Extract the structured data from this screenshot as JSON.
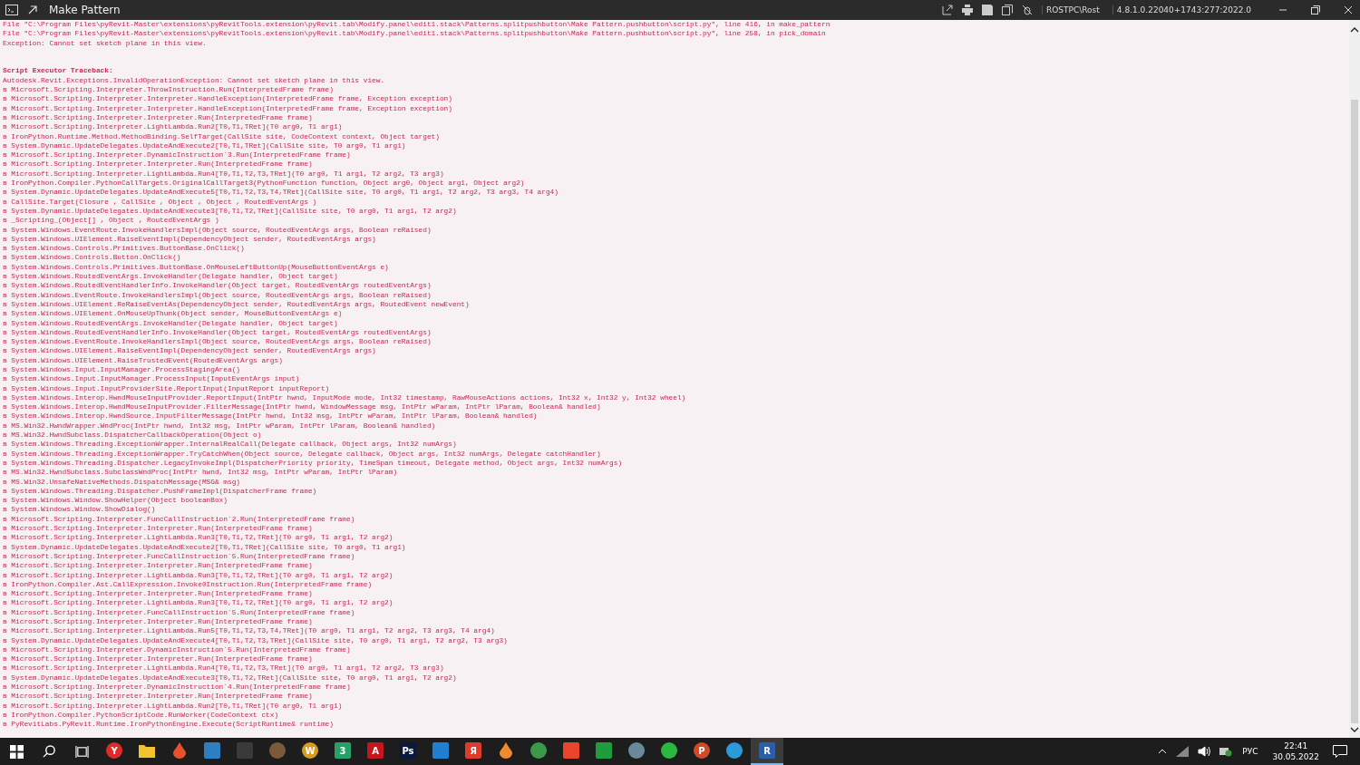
{
  "window": {
    "title": "Make Pattern",
    "user": "ROSTPC\\Rost",
    "version": "4.8.1.0.22040+1743:277:2022.0"
  },
  "output": {
    "lines": [
      {
        "kind": "error",
        "text": "File \"C:\\Program Files\\pyRevit-Master\\extensions\\pyRevitTools.extension\\pyRevit.tab\\Modify.panel\\edit1.stack\\Patterns.splitpushbutton\\Make Pattern.pushbutton\\script.py\", line 416, in make_pattern"
      },
      {
        "kind": "error",
        "text": "File \"C:\\Program Files\\pyRevit-Master\\extensions\\pyRevitTools.extension\\pyRevit.tab\\Modify.panel\\edit1.stack\\Patterns.splitpushbutton\\Make Pattern.pushbutton\\script.py\", line 258, in pick_domain"
      },
      {
        "kind": "error",
        "text": "Exception: Cannot set sketch plane in this view."
      },
      {
        "kind": "blank"
      },
      {
        "kind": "blank"
      },
      {
        "kind": "heading",
        "text": "Script Executor Traceback:"
      },
      {
        "kind": "error",
        "text": "Autodesk.Revit.Exceptions.InvalidOperationException: Cannot set sketch plane in this view."
      },
      {
        "kind": "frame",
        "text": "в Microsoft.Scripting.Interpreter.ThrowInstruction.Run(InterpretedFrame frame)"
      },
      {
        "kind": "frame",
        "text": "в Microsoft.Scripting.Interpreter.Interpreter.HandleException(InterpretedFrame frame, Exception exception)"
      },
      {
        "kind": "frame",
        "text": "в Microsoft.Scripting.Interpreter.Interpreter.HandleException(InterpretedFrame frame, Exception exception)"
      },
      {
        "kind": "frame",
        "text": "в Microsoft.Scripting.Interpreter.Interpreter.Run(InterpretedFrame frame)"
      },
      {
        "kind": "frame",
        "text": "в Microsoft.Scripting.Interpreter.LightLambda.Run2[T0,T1,TRet](T0 arg0, T1 arg1)"
      },
      {
        "kind": "frame",
        "text": "в IronPython.Runtime.Method.MethodBinding.SelfTarget(CallSite site, CodeContext context, Object target)"
      },
      {
        "kind": "frame",
        "text": "в System.Dynamic.UpdateDelegates.UpdateAndExecute2[T0,T1,TRet](CallSite site, T0 arg0, T1 arg1)"
      },
      {
        "kind": "frame",
        "text": "в Microsoft.Scripting.Interpreter.DynamicInstruction`3.Run(InterpretedFrame frame)"
      },
      {
        "kind": "frame",
        "text": "в Microsoft.Scripting.Interpreter.Interpreter.Run(InterpretedFrame frame)"
      },
      {
        "kind": "frame",
        "text": "в Microsoft.Scripting.Interpreter.LightLambda.Run4[T0,T1,T2,T3,TRet](T0 arg0, T1 arg1, T2 arg2, T3 arg3)"
      },
      {
        "kind": "frame",
        "text": "в IronPython.Compiler.PythonCallTargets.OriginalCallTarget3(PythonFunction function, Object arg0, Object arg1, Object arg2)"
      },
      {
        "kind": "frame",
        "text": "в System.Dynamic.UpdateDelegates.UpdateAndExecute5[T0,T1,T2,T3,T4,TRet](CallSite site, T0 arg0, T1 arg1, T2 arg2, T3 arg3, T4 arg4)"
      },
      {
        "kind": "frame",
        "text": "в CallSite.Target(Closure , CallSite , Object , Object , RoutedEventArgs )"
      },
      {
        "kind": "frame",
        "text": "в System.Dynamic.UpdateDelegates.UpdateAndExecute3[T0,T1,T2,TRet](CallSite site, T0 arg0, T1 arg1, T2 arg2)"
      },
      {
        "kind": "frame",
        "text": "в _Scripting_(Object[] , Object , RoutedEventArgs )"
      },
      {
        "kind": "frame",
        "text": "в System.Windows.EventRoute.InvokeHandlersImpl(Object source, RoutedEventArgs args, Boolean reRaised)"
      },
      {
        "kind": "frame",
        "text": "в System.Windows.UIElement.RaiseEventImpl(DependencyObject sender, RoutedEventArgs args)"
      },
      {
        "kind": "frame",
        "text": "в System.Windows.Controls.Primitives.ButtonBase.OnClick()"
      },
      {
        "kind": "frame",
        "text": "в System.Windows.Controls.Button.OnClick()"
      },
      {
        "kind": "frame",
        "text": "в System.Windows.Controls.Primitives.ButtonBase.OnMouseLeftButtonUp(MouseButtonEventArgs e)"
      },
      {
        "kind": "frame",
        "text": "в System.Windows.RoutedEventArgs.InvokeHandler(Delegate handler, Object target)"
      },
      {
        "kind": "frame",
        "text": "в System.Windows.RoutedEventHandlerInfo.InvokeHandler(Object target, RoutedEventArgs routedEventArgs)"
      },
      {
        "kind": "frame",
        "text": "в System.Windows.EventRoute.InvokeHandlersImpl(Object source, RoutedEventArgs args, Boolean reRaised)"
      },
      {
        "kind": "frame",
        "text": "в System.Windows.UIElement.ReRaiseEventAs(DependencyObject sender, RoutedEventArgs args, RoutedEvent newEvent)"
      },
      {
        "kind": "frame",
        "text": "в System.Windows.UIElement.OnMouseUpThunk(Object sender, MouseButtonEventArgs e)"
      },
      {
        "kind": "frame",
        "text": "в System.Windows.RoutedEventArgs.InvokeHandler(Delegate handler, Object target)"
      },
      {
        "kind": "frame",
        "text": "в System.Windows.RoutedEventHandlerInfo.InvokeHandler(Object target, RoutedEventArgs routedEventArgs)"
      },
      {
        "kind": "frame",
        "text": "в System.Windows.EventRoute.InvokeHandlersImpl(Object source, RoutedEventArgs args, Boolean reRaised)"
      },
      {
        "kind": "frame",
        "text": "в System.Windows.UIElement.RaiseEventImpl(DependencyObject sender, RoutedEventArgs args)"
      },
      {
        "kind": "frame",
        "text": "в System.Windows.UIElement.RaiseTrustedEvent(RoutedEventArgs args)"
      },
      {
        "kind": "frame",
        "text": "в System.Windows.Input.InputManager.ProcessStagingArea()"
      },
      {
        "kind": "frame",
        "text": "в System.Windows.Input.InputManager.ProcessInput(InputEventArgs input)"
      },
      {
        "kind": "frame",
        "text": "в System.Windows.Input.InputProviderSite.ReportInput(InputReport inputReport)"
      },
      {
        "kind": "frame",
        "text": "в System.Windows.Interop.HwndMouseInputProvider.ReportInput(IntPtr hwnd, InputMode mode, Int32 timestamp, RawMouseActions actions, Int32 x, Int32 y, Int32 wheel)"
      },
      {
        "kind": "frame",
        "text": "в System.Windows.Interop.HwndMouseInputProvider.FilterMessage(IntPtr hwnd, WindowMessage msg, IntPtr wParam, IntPtr lParam, Boolean& handled)"
      },
      {
        "kind": "frame",
        "text": "в System.Windows.Interop.HwndSource.InputFilterMessage(IntPtr hwnd, Int32 msg, IntPtr wParam, IntPtr lParam, Boolean& handled)"
      },
      {
        "kind": "frame",
        "text": "в MS.Win32.HwndWrapper.WndProc(IntPtr hwnd, Int32 msg, IntPtr wParam, IntPtr lParam, Boolean& handled)"
      },
      {
        "kind": "frame",
        "text": "в MS.Win32.HwndSubclass.DispatcherCallbackOperation(Object o)"
      },
      {
        "kind": "frame",
        "text": "в System.Windows.Threading.ExceptionWrapper.InternalRealCall(Delegate callback, Object args, Int32 numArgs)"
      },
      {
        "kind": "frame",
        "text": "в System.Windows.Threading.ExceptionWrapper.TryCatchWhen(Object source, Delegate callback, Object args, Int32 numArgs, Delegate catchHandler)"
      },
      {
        "kind": "frame",
        "text": "в System.Windows.Threading.Dispatcher.LegacyInvokeImpl(DispatcherPriority priority, TimeSpan timeout, Delegate method, Object args, Int32 numArgs)"
      },
      {
        "kind": "frame",
        "text": "в MS.Win32.HwndSubclass.SubclassWndProc(IntPtr hwnd, Int32 msg, IntPtr wParam, IntPtr lParam)"
      },
      {
        "kind": "frame",
        "text": "в MS.Win32.UnsafeNativeMethods.DispatchMessage(MSG& msg)"
      },
      {
        "kind": "frame",
        "text": "в System.Windows.Threading.Dispatcher.PushFrameImpl(DispatcherFrame frame)"
      },
      {
        "kind": "frame",
        "text": "в System.Windows.Window.ShowHelper(Object booleanBox)"
      },
      {
        "kind": "frame",
        "text": "в System.Windows.Window.ShowDialog()"
      },
      {
        "kind": "frame",
        "text": "в Microsoft.Scripting.Interpreter.FuncCallInstruction`2.Run(InterpretedFrame frame)"
      },
      {
        "kind": "frame",
        "text": "в Microsoft.Scripting.Interpreter.Interpreter.Run(InterpretedFrame frame)"
      },
      {
        "kind": "frame",
        "text": "в Microsoft.Scripting.Interpreter.LightLambda.Run3[T0,T1,T2,TRet](T0 arg0, T1 arg1, T2 arg2)"
      },
      {
        "kind": "frame",
        "text": "в System.Dynamic.UpdateDelegates.UpdateAndExecute2[T0,T1,TRet](CallSite site, T0 arg0, T1 arg1)"
      },
      {
        "kind": "frame",
        "text": "в Microsoft.Scripting.Interpreter.FuncCallInstruction`5.Run(InterpretedFrame frame)"
      },
      {
        "kind": "frame",
        "text": "в Microsoft.Scripting.Interpreter.Interpreter.Run(InterpretedFrame frame)"
      },
      {
        "kind": "frame",
        "text": "в Microsoft.Scripting.Interpreter.LightLambda.Run3[T0,T1,T2,TRet](T0 arg0, T1 arg1, T2 arg2)"
      },
      {
        "kind": "frame",
        "text": "в IronPython.Compiler.Ast.CallExpression.Invoke0Instruction.Run(InterpretedFrame frame)"
      },
      {
        "kind": "frame",
        "text": "в Microsoft.Scripting.Interpreter.Interpreter.Run(InterpretedFrame frame)"
      },
      {
        "kind": "frame",
        "text": "в Microsoft.Scripting.Interpreter.LightLambda.Run3[T0,T1,T2,TRet](T0 arg0, T1 arg1, T2 arg2)"
      },
      {
        "kind": "frame",
        "text": "в Microsoft.Scripting.Interpreter.FuncCallInstruction`5.Run(InterpretedFrame frame)"
      },
      {
        "kind": "frame",
        "text": "в Microsoft.Scripting.Interpreter.Interpreter.Run(InterpretedFrame frame)"
      },
      {
        "kind": "frame",
        "text": "в Microsoft.Scripting.Interpreter.LightLambda.Run5[T0,T1,T2,T3,T4,TRet](T0 arg0, T1 arg1, T2 arg2, T3 arg3, T4 arg4)"
      },
      {
        "kind": "frame",
        "text": "в System.Dynamic.UpdateDelegates.UpdateAndExecute4[T0,T1,T2,T3,TRet](CallSite site, T0 arg0, T1 arg1, T2 arg2, T3 arg3)"
      },
      {
        "kind": "frame",
        "text": "в Microsoft.Scripting.Interpreter.DynamicInstruction`5.Run(InterpretedFrame frame)"
      },
      {
        "kind": "frame",
        "text": "в Microsoft.Scripting.Interpreter.Interpreter.Run(InterpretedFrame frame)"
      },
      {
        "kind": "frame",
        "text": "в Microsoft.Scripting.Interpreter.LightLambda.Run4[T0,T1,T2,T3,TRet](T0 arg0, T1 arg1, T2 arg2, T3 arg3)"
      },
      {
        "kind": "frame",
        "text": "в System.Dynamic.UpdateDelegates.UpdateAndExecute3[T0,T1,T2,TRet](CallSite site, T0 arg0, T1 arg1, T2 arg2)"
      },
      {
        "kind": "frame",
        "text": "в Microsoft.Scripting.Interpreter.DynamicInstruction`4.Run(InterpretedFrame frame)"
      },
      {
        "kind": "frame",
        "text": "в Microsoft.Scripting.Interpreter.Interpreter.Run(InterpretedFrame frame)"
      },
      {
        "kind": "frame",
        "text": "в Microsoft.Scripting.Interpreter.LightLambda.Run2[T0,T1,TRet](T0 arg0, T1 arg1)"
      },
      {
        "kind": "frame",
        "text": "в IronPython.Compiler.PythonScriptCode.RunWorker(CodeContext ctx)"
      },
      {
        "kind": "frame",
        "text": "в PyRevitLabs.PyRevit.Runtime.IronPythonEngine.Execute(ScriptRuntime& runtime)"
      }
    ]
  },
  "taskbar": {
    "apps": [
      {
        "kind": "circle",
        "color": "#e02a2a",
        "glyph": "Y",
        "selected": false
      },
      {
        "kind": "folder",
        "color": "#f2c230",
        "selected": false
      },
      {
        "kind": "drop",
        "color": "#e8522a",
        "selected": false
      },
      {
        "kind": "square",
        "color": "#2d7fc1",
        "selected": false
      },
      {
        "kind": "square",
        "color": "#3a3a3a",
        "selected": false
      },
      {
        "kind": "circle",
        "color": "#7a5a3a",
        "selected": false
      },
      {
        "kind": "circle",
        "color": "#d89a20",
        "glyph": "W",
        "selected": false
      },
      {
        "kind": "square",
        "color": "#26a269",
        "glyph": "3",
        "selected": false
      },
      {
        "kind": "square",
        "color": "#c4161c",
        "glyph": "A",
        "selected": false
      },
      {
        "kind": "square",
        "color": "#0a1a3a",
        "glyph": "Ps",
        "selected": false
      },
      {
        "kind": "square",
        "color": "#1f7fd0",
        "selected": false
      },
      {
        "kind": "square",
        "color": "#e03a2a",
        "glyph": "Я",
        "selected": false
      },
      {
        "kind": "drop",
        "color": "#f08a30",
        "selected": false
      },
      {
        "kind": "circle",
        "color": "#3a9a4a",
        "selected": false
      },
      {
        "kind": "square",
        "color": "#e8452a",
        "selected": false
      },
      {
        "kind": "square",
        "color": "#1e9c3e",
        "selected": false
      },
      {
        "kind": "circle",
        "color": "#6a8a9a",
        "selected": false
      },
      {
        "kind": "circle",
        "color": "#2ab840",
        "selected": false
      },
      {
        "kind": "circle",
        "color": "#d04a2a",
        "glyph": "P",
        "selected": false
      },
      {
        "kind": "circle",
        "color": "#2a9ad8",
        "selected": false
      },
      {
        "kind": "square",
        "color": "#2a5ea8",
        "glyph": "R",
        "selected": true
      }
    ],
    "tray": {
      "language": "РУС",
      "time": "22:41",
      "date": "30.05.2022"
    }
  }
}
